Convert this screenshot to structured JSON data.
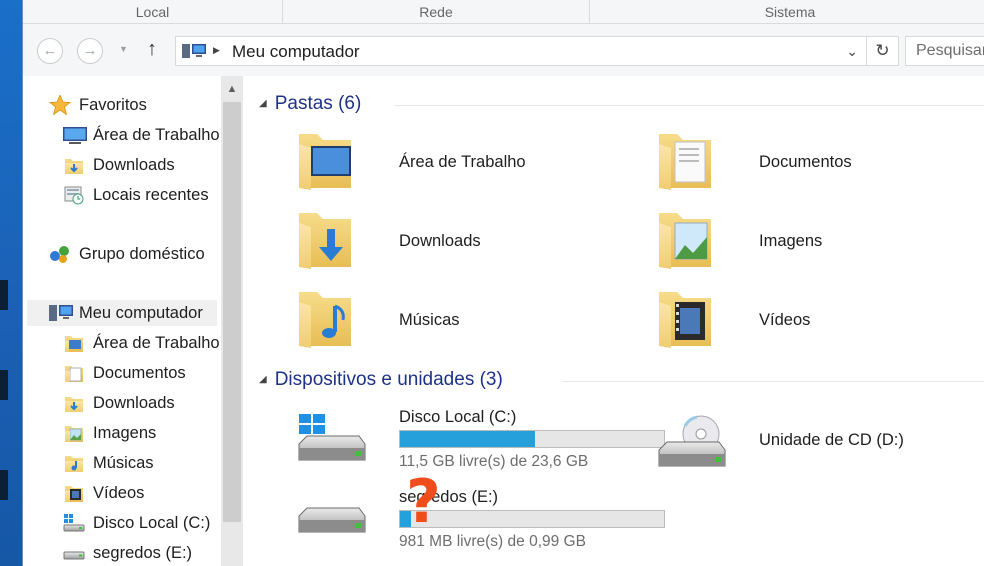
{
  "ribbon": {
    "groups": [
      "Local",
      "Rede",
      "Sistema"
    ]
  },
  "address_bar": {
    "path": "Meu computador",
    "search_placeholder": "Pesquisar"
  },
  "nav_pane": {
    "favorites": {
      "label": "Favoritos",
      "items": [
        {
          "label": "Área de Trabalho",
          "icon": "desktop-icon"
        },
        {
          "label": "Downloads",
          "icon": "downloads-folder-icon"
        },
        {
          "label": "Locais recentes",
          "icon": "recent-places-icon"
        }
      ]
    },
    "homegroup": {
      "label": "Grupo doméstico"
    },
    "computer": {
      "label": "Meu computador",
      "items": [
        {
          "label": "Área de Trabalho",
          "icon": "desktop-folder-icon"
        },
        {
          "label": "Documentos",
          "icon": "documents-folder-icon"
        },
        {
          "label": "Downloads",
          "icon": "downloads-folder-icon"
        },
        {
          "label": "Imagens",
          "icon": "pictures-folder-icon"
        },
        {
          "label": "Músicas",
          "icon": "music-folder-icon"
        },
        {
          "label": "Vídeos",
          "icon": "videos-folder-icon"
        },
        {
          "label": "Disco Local (C:)",
          "icon": "windows-drive-icon"
        },
        {
          "label": "segredos (E:)",
          "icon": "drive-icon"
        }
      ]
    }
  },
  "content": {
    "folders_header": "Pastas (6)",
    "folders": [
      {
        "label": "Área de Trabalho",
        "icon": "desktop-folder-icon"
      },
      {
        "label": "Documentos",
        "icon": "documents-folder-icon"
      },
      {
        "label": "Downloads",
        "icon": "downloads-folder-icon"
      },
      {
        "label": "Imagens",
        "icon": "pictures-folder-icon"
      },
      {
        "label": "Músicas",
        "icon": "music-folder-icon"
      },
      {
        "label": "Vídeos",
        "icon": "videos-folder-icon"
      }
    ],
    "devices_header": "Dispositivos e unidades (3)",
    "devices": [
      {
        "label": "Disco Local (C:)",
        "free": "11,5 GB livre(s) de 23,6 GB",
        "used_fraction": 0.51,
        "icon": "windows-drive-icon"
      },
      {
        "label": "Unidade de CD (D:)",
        "icon": "cd-drive-icon"
      },
      {
        "label": "segredos (E:)",
        "free": "981 MB livre(s) de 0,99 GB",
        "used_fraction": 0.04,
        "icon": "drive-icon"
      }
    ]
  },
  "annotation": {
    "text": "?",
    "color": "#f04d1c"
  },
  "colors": {
    "header_blue": "#1e3287",
    "progress_blue": "#26a0da",
    "folder_yellow": "#f3d277"
  }
}
